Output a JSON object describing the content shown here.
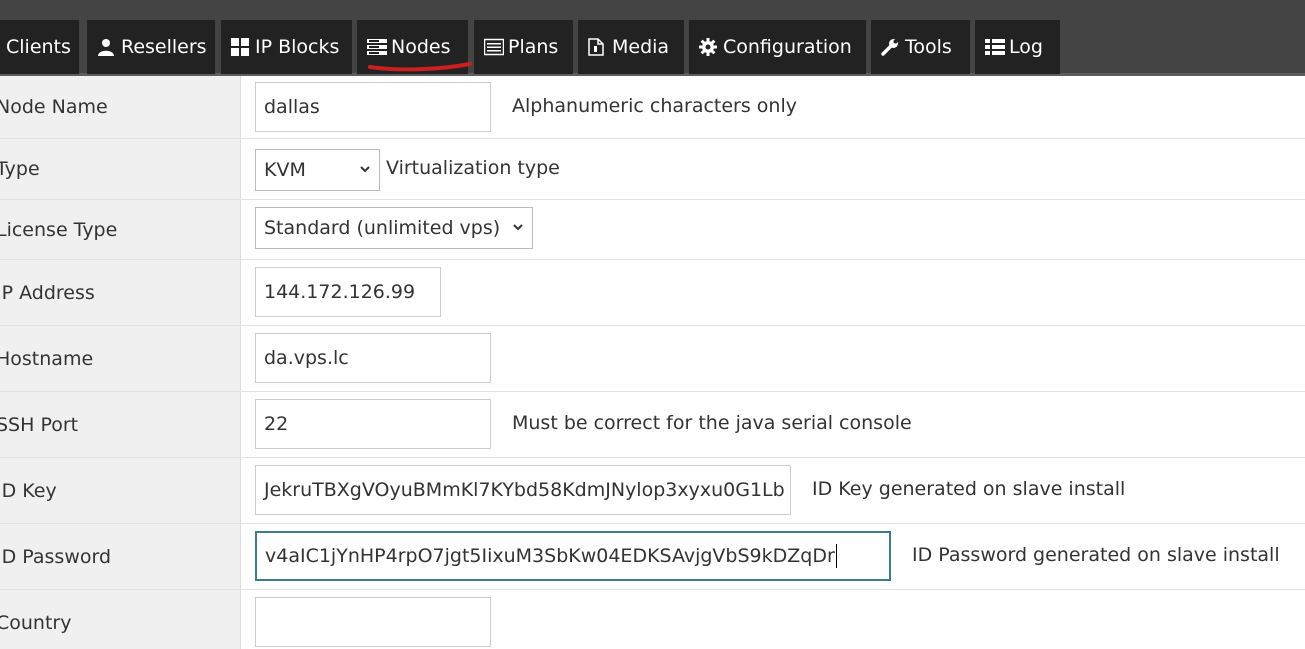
{
  "nav": {
    "tabs": [
      {
        "label": "Clients",
        "icon": "none"
      },
      {
        "label": "Resellers",
        "icon": "user-icon"
      },
      {
        "label": "IP Blocks",
        "icon": "grid-icon"
      },
      {
        "label": "Nodes",
        "icon": "server-icon"
      },
      {
        "label": "Plans",
        "icon": "list-alt-icon"
      },
      {
        "label": "Media",
        "icon": "file-icon"
      },
      {
        "label": "Configuration",
        "icon": "gear-icon"
      },
      {
        "label": "Tools",
        "icon": "wrench-icon"
      },
      {
        "label": "Log",
        "icon": "list-icon"
      }
    ],
    "highlighted_tab": "Nodes",
    "highlight_color": "#cc1f1f"
  },
  "form": {
    "node_name": {
      "label": "Node Name",
      "value": "dallas",
      "hint": "Alphanumeric characters only"
    },
    "type": {
      "label": "Type",
      "value": "KVM",
      "hint": "Virtualization type"
    },
    "license_type": {
      "label": "License Type",
      "value": "Standard (unlimited vps)"
    },
    "ip_address": {
      "label": "IP Address",
      "value": "144.172.126.99"
    },
    "hostname": {
      "label": "Hostname",
      "value": "da.vps.lc"
    },
    "ssh_port": {
      "label": "SSH Port",
      "value": "22",
      "hint": "Must be correct for the java serial console"
    },
    "id_key": {
      "label": "ID Key",
      "value": "JekruTBXgVOyuBMmKl7KYbd58KdmJNylop3xyxu0G1Lb",
      "hint": "ID Key generated on slave install"
    },
    "id_password": {
      "label": "ID Password",
      "value": "v4aIC1jYnHP4rpO7jgt5IixuM3SbKw04EDKSAvjgVbS9kDZqDr",
      "hint": "ID Password generated on slave install"
    },
    "country": {
      "label": "Country",
      "value": ""
    }
  },
  "colors": {
    "topbar": "#444444",
    "tab_bg": "#222222",
    "label_bg": "#f0f0f0",
    "focus_border": "#3b7c8e"
  }
}
